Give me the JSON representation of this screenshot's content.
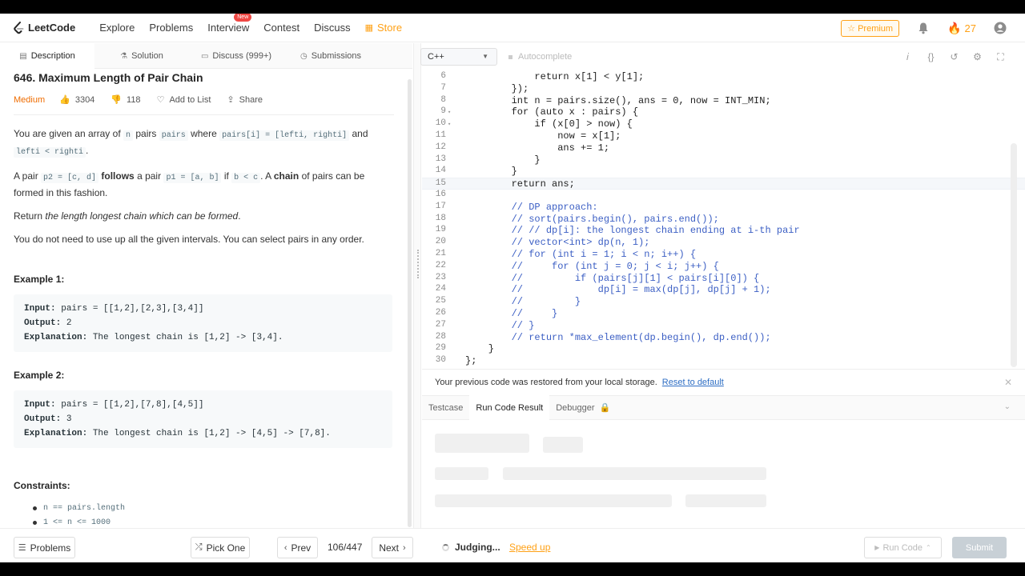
{
  "nav": {
    "logo": "LeetCode",
    "links": [
      "Explore",
      "Problems",
      "Interview",
      "Contest",
      "Discuss"
    ],
    "interview_badge": "New",
    "store": "Store",
    "premium": "Premium",
    "streak": "27",
    "accent_color": "#ffa116"
  },
  "left_tabs": [
    "Description",
    "Solution",
    "Discuss (999+)",
    "Submissions"
  ],
  "problem": {
    "title": "646. Maximum Length of Pair Chain",
    "difficulty": "Medium",
    "likes": "3304",
    "dislikes": "118",
    "add_to_list": "Add to List",
    "share": "Share",
    "d1_a": "You are given an array of",
    "d1_n": "n",
    "d1_b": "pairs",
    "d1_pairs": "pairs",
    "d1_c": "where",
    "d1_eq": "pairs[i] = [lefti, righti]",
    "d1_d": "and",
    "d1_lt": "lefti < righti",
    "d1_e": ".",
    "d2_a": "A pair",
    "d2_p2": "p2 = [c, d]",
    "d2_follows": "follows",
    "d2_b": "a pair",
    "d2_p1": "p1 = [a, b]",
    "d2_if": "if",
    "d2_cond": "b < c",
    "d2_c": ". A",
    "d2_chain": "chain",
    "d2_d": "of pairs can be formed in this fashion.",
    "d3_a": "Return",
    "d3_i": "the length longest chain which can be formed",
    "d3_b": ".",
    "d4": "You do not need to use up all the given intervals. You can select pairs in any order.",
    "ex1_h": "Example 1:",
    "ex1_input": "pairs = [[1,2],[2,3],[3,4]]",
    "ex1_output": "2",
    "ex1_expl": "The longest chain is [1,2] -> [3,4].",
    "ex2_h": "Example 2:",
    "ex2_input": "pairs = [[1,2],[7,8],[4,5]]",
    "ex2_output": "3",
    "ex2_expl": "The longest chain is [1,2] -> [4,5] -> [7,8].",
    "lbl_input": "Input:",
    "lbl_output": "Output:",
    "lbl_expl": "Explanation:",
    "constraints_h": "Constraints:",
    "constraints": [
      "n == pairs.length",
      "1 <= n <= 1000"
    ]
  },
  "editor": {
    "language": "C++",
    "autocomplete": "Autocomplete",
    "lines": [
      {
        "n": "6",
        "text": "            return x[1] < y[1];",
        "fold": ""
      },
      {
        "n": "7",
        "text": "        });",
        "fold": ""
      },
      {
        "n": "8",
        "text": "        int n = pairs.size(), ans = 0, now = INT_MIN;",
        "fold": ""
      },
      {
        "n": "9",
        "text": "        for (auto x : pairs) {",
        "fold": "▾"
      },
      {
        "n": "10",
        "text": "            if (x[0] > now) {",
        "fold": "▾"
      },
      {
        "n": "11",
        "text": "                now = x[1];",
        "fold": ""
      },
      {
        "n": "12",
        "text": "                ans += 1;",
        "fold": ""
      },
      {
        "n": "13",
        "text": "            }",
        "fold": ""
      },
      {
        "n": "14",
        "text": "        }",
        "fold": ""
      },
      {
        "n": "15",
        "text": "        return ans;",
        "fold": ""
      },
      {
        "n": "16",
        "text": "",
        "fold": ""
      },
      {
        "n": "17",
        "text": "        // DP approach:",
        "fold": ""
      },
      {
        "n": "18",
        "text": "        // sort(pairs.begin(), pairs.end());",
        "fold": ""
      },
      {
        "n": "19",
        "text": "        // // dp[i]: the longest chain ending at i-th pair",
        "fold": ""
      },
      {
        "n": "20",
        "text": "        // vector<int> dp(n, 1);",
        "fold": ""
      },
      {
        "n": "21",
        "text": "        // for (int i = 1; i < n; i++) {",
        "fold": ""
      },
      {
        "n": "22",
        "text": "        //     for (int j = 0; j < i; j++) {",
        "fold": ""
      },
      {
        "n": "23",
        "text": "        //         if (pairs[j][1] < pairs[i][0]) {",
        "fold": ""
      },
      {
        "n": "24",
        "text": "        //             dp[i] = max(dp[j], dp[j] + 1);",
        "fold": ""
      },
      {
        "n": "25",
        "text": "        //         }",
        "fold": ""
      },
      {
        "n": "26",
        "text": "        //     }",
        "fold": ""
      },
      {
        "n": "27",
        "text": "        // }",
        "fold": ""
      },
      {
        "n": "28",
        "text": "        // return *max_element(dp.begin(), dp.end());",
        "fold": ""
      },
      {
        "n": "29",
        "text": "    }",
        "fold": ""
      },
      {
        "n": "30",
        "text": "};",
        "fold": ""
      }
    ],
    "new_badge": "NEW"
  },
  "restore": {
    "message": "Your previous code was restored from your local storage.",
    "reset": "Reset to default"
  },
  "bottom_tabs": [
    "Testcase",
    "Run Code Result",
    "Debugger"
  ],
  "footer": {
    "problems": "Problems",
    "pick_one": "Pick One",
    "prev": "Prev",
    "counter": "106/447",
    "next": "Next",
    "judging": "Judging...",
    "speed_up": "Speed up",
    "run_code": "Run Code",
    "submit": "Submit"
  }
}
